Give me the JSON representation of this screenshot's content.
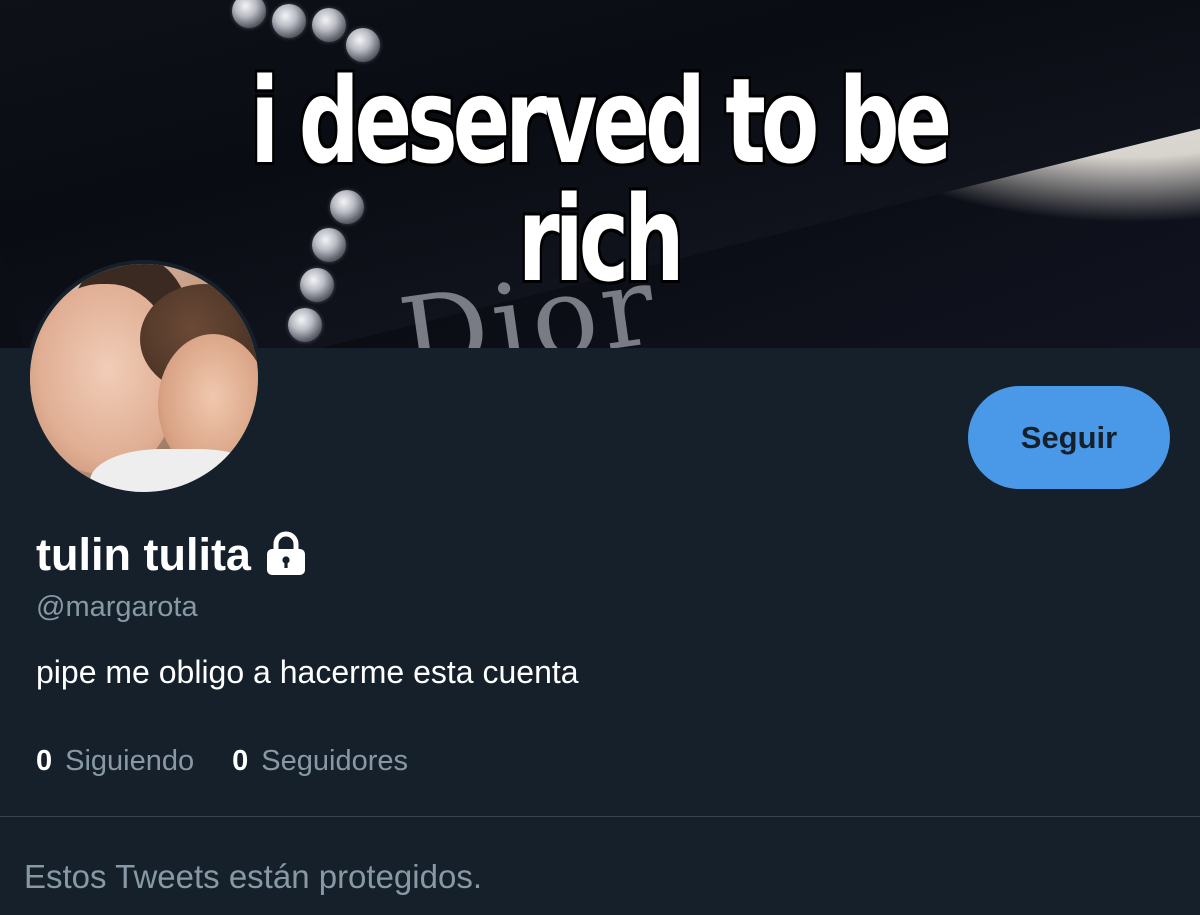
{
  "banner": {
    "caption": "i deserved to be rich",
    "logo_text": "Dior"
  },
  "profile": {
    "display_name": "tulin tulita",
    "handle": "@margarota",
    "bio": "pipe me obligo a hacerme esta cuenta",
    "protected_icon": "lock-icon"
  },
  "actions": {
    "follow_label": "Seguir"
  },
  "stats": {
    "following_count": "0",
    "following_label": "Siguiendo",
    "followers_count": "0",
    "followers_label": "Seguidores"
  },
  "timeline": {
    "protected_message": "Estos Tweets están protegidos."
  },
  "colors": {
    "background": "#15202b",
    "accent": "#4a99e9",
    "secondary_text": "#8899a6",
    "divider": "#38444d"
  }
}
